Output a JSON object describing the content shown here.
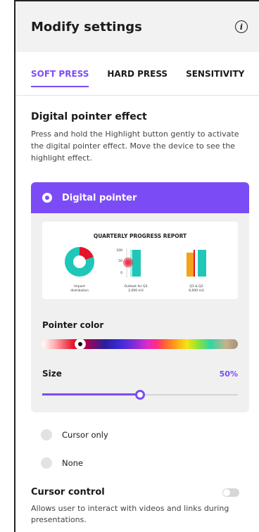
{
  "header": {
    "title": "Modify settings",
    "info_icon": "info-icon"
  },
  "tabs": [
    {
      "label": "SOFT PRESS",
      "active": true
    },
    {
      "label": "HARD PRESS",
      "active": false
    },
    {
      "label": "SENSITIVITY",
      "active": false
    }
  ],
  "section": {
    "title": "Digital pointer effect",
    "description": "Press and hold the Highlight button gently to activate the digital pointer effect. Move the device to see the highlight effect."
  },
  "pointer_card": {
    "label": "Digital pointer",
    "selected": true,
    "preview": {
      "title": "QUARTERLY PROGRESS REPORT",
      "captions": [
        {
          "line1": "Impact",
          "line2": "distribution"
        },
        {
          "line1": "Outlook for Q3",
          "line2": "2,000 m3"
        },
        {
          "line1": "Q1 & Q2",
          "line2": "6,000 m3"
        }
      ],
      "axis_ticks": [
        "100",
        "50",
        "0"
      ]
    },
    "pointer_color_label": "Pointer color",
    "pointer_color": "#e8122a",
    "size_label": "Size",
    "size_value": "50%",
    "size_fraction": 0.5
  },
  "options": [
    {
      "label": "Cursor only",
      "selected": false
    },
    {
      "label": "None",
      "selected": false
    }
  ],
  "cursor_control": {
    "title": "Cursor control",
    "enabled": false,
    "description": "Allows user to interact with videos and links during presentations."
  },
  "colors": {
    "accent": "#7b4cf5",
    "teal": "#1fc7b8",
    "orange": "#f5a31a",
    "red": "#e8122a"
  }
}
